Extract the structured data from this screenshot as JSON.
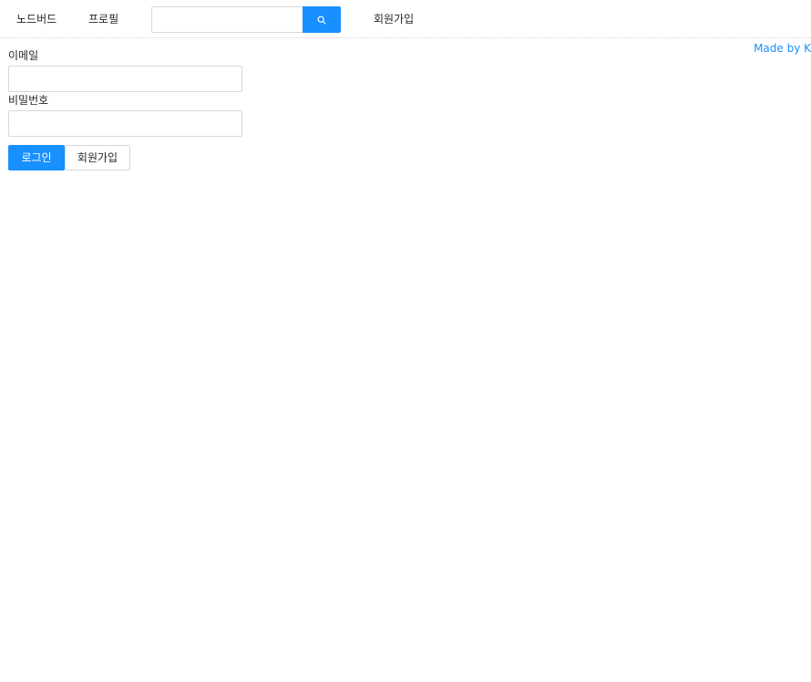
{
  "nav": {
    "home_label": "노드버드",
    "profile_label": "프로필",
    "signup_label": "회원가입",
    "search": {
      "placeholder": "",
      "value": "",
      "button_icon": "search-icon"
    }
  },
  "credit": {
    "text": "Made by K"
  },
  "login_form": {
    "email_label": "이메일",
    "email_value": "",
    "password_label": "비밀번호",
    "password_value": "",
    "login_button": "로그인",
    "signup_button": "회원가입"
  },
  "colors": {
    "primary": "#1890ff",
    "border": "#d9d9d9",
    "text": "#262626"
  }
}
